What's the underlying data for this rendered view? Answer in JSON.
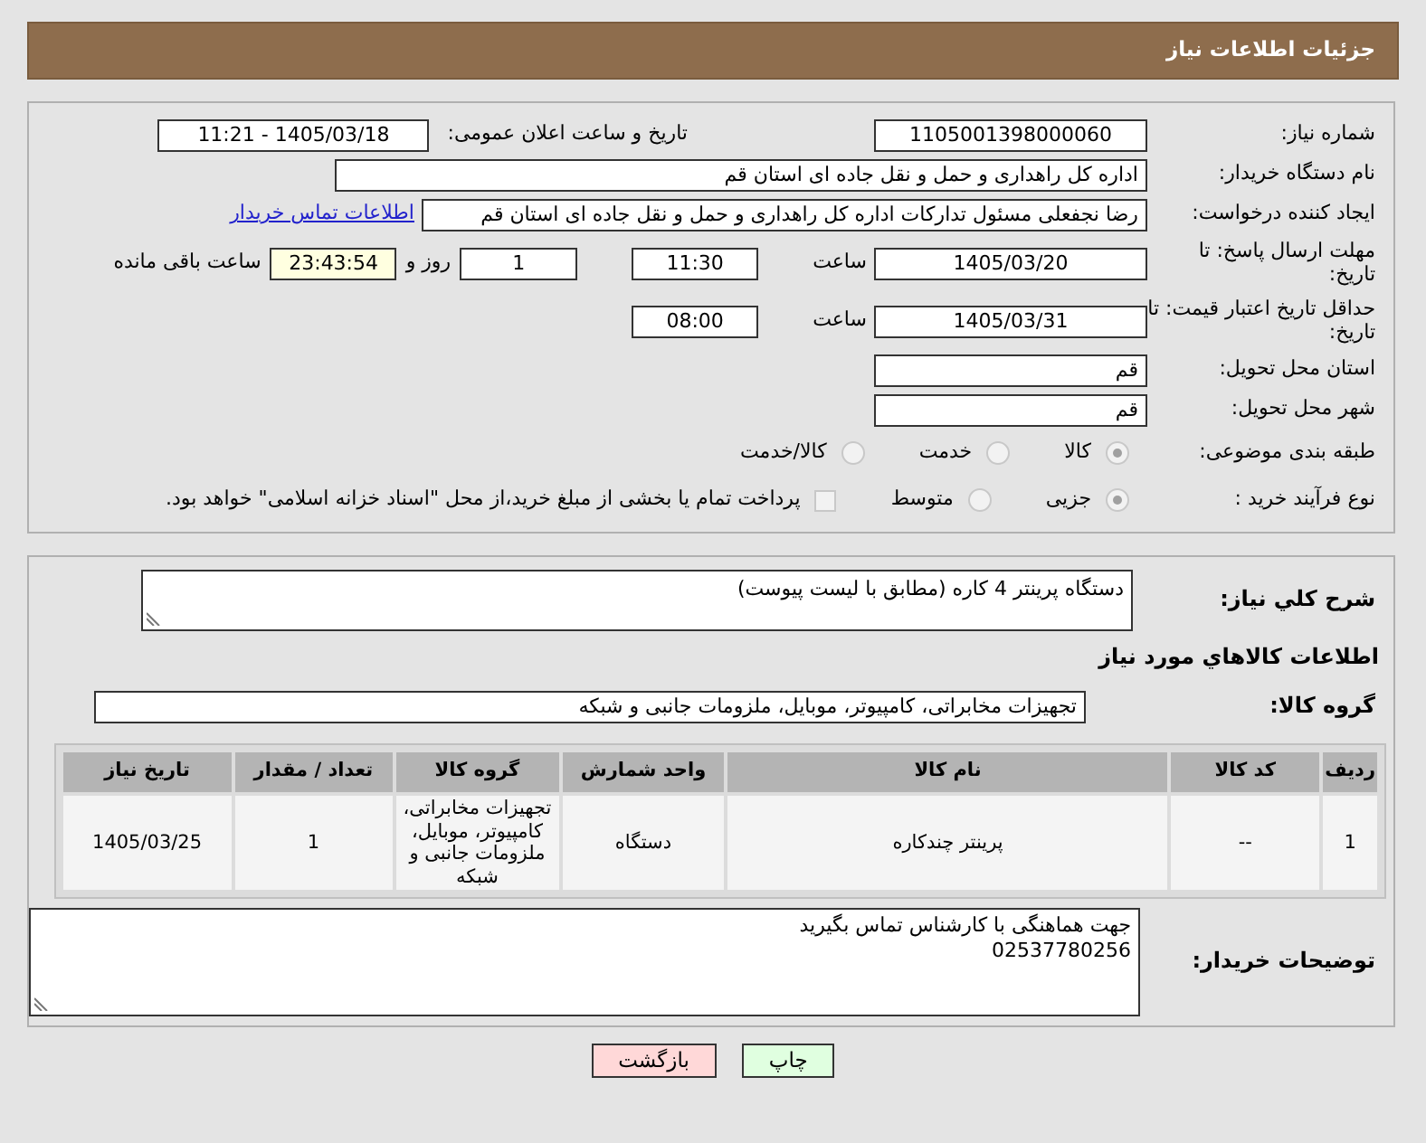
{
  "header": {
    "title": "جزئیات اطلاعات نیاز"
  },
  "need_number": {
    "label": "شماره نیاز:",
    "value": "1105001398000060"
  },
  "announce": {
    "label": "تاریخ و ساعت اعلان عمومی:",
    "value": "1405/03/18 - 11:21"
  },
  "buyer_org": {
    "label": "نام دستگاه خریدار:",
    "value": "اداره کل راهداری و حمل و نقل جاده ای استان قم"
  },
  "requester": {
    "label": "ایجاد کننده درخواست:",
    "value": "رضا  نجفعلی مسئول تدارکات اداره کل راهداری و حمل و نقل جاده ای استان قم",
    "link": "اطلاعات تماس خریدار"
  },
  "reply_deadline": {
    "label": "مهلت ارسال پاسخ: تا تاریخ:",
    "date": "1405/03/20",
    "time_label": "ساعت",
    "time": "11:30",
    "days": "1",
    "days_label": "روز و",
    "remaining": "23:43:54",
    "remaining_label": "ساعت باقی مانده"
  },
  "price_validity": {
    "label": "حداقل تاریخ اعتبار قیمت: تا تاریخ:",
    "date": "1405/03/31",
    "time_label": "ساعت",
    "time": "08:00"
  },
  "province": {
    "label": "استان محل تحویل:",
    "value": "قم"
  },
  "city": {
    "label": "شهر محل تحویل:",
    "value": "قم"
  },
  "category": {
    "label": "طبقه بندی موضوعی:",
    "options": [
      {
        "label": "کالا",
        "selected": true
      },
      {
        "label": "خدمت",
        "selected": false
      },
      {
        "label": "کالا/خدمت",
        "selected": false
      }
    ]
  },
  "process": {
    "label": "نوع فرآیند خرید :",
    "options": [
      {
        "label": "جزیی",
        "selected": true
      },
      {
        "label": "متوسط",
        "selected": false
      }
    ],
    "treasury": {
      "label": "پرداخت تمام یا بخشی از مبلغ خرید،از محل \"اسناد خزانه اسلامی\" خواهد بود.",
      "checked": false
    }
  },
  "description": {
    "label": "شرح کلي نياز:",
    "value": "دستگاه پرینتر 4 کاره (مطابق با لیست پیوست)"
  },
  "goods_title": "اطلاعات کالاهاي مورد نياز",
  "goods_group": {
    "label": "گروه کالا:",
    "value": "تجهیزات مخابراتی، کامپیوتر، موبایل، ملزومات جانبی و شبکه"
  },
  "table": {
    "columns": [
      "ردیف",
      "کد کالا",
      "نام کالا",
      "واحد شمارش",
      "گروه کالا",
      "تعداد / مقدار",
      "تاریخ نیاز"
    ],
    "rows": [
      [
        "1",
        "--",
        "پرینتر چندکاره",
        "دستگاه",
        "تجهیزات مخابراتی، کامپیوتر، موبایل، ملزومات جانبی و شبکه",
        "1",
        "1405/03/25"
      ]
    ]
  },
  "buyer_notes": {
    "label": "توضیحات خریدار:",
    "lines": [
      "جهت هماهنگی با کارشناس تماس بگیرید",
      "02537780256"
    ]
  },
  "buttons": [
    {
      "label": "چاپ",
      "kind": "print"
    },
    {
      "label": "بازگشت",
      "kind": "back"
    }
  ]
}
